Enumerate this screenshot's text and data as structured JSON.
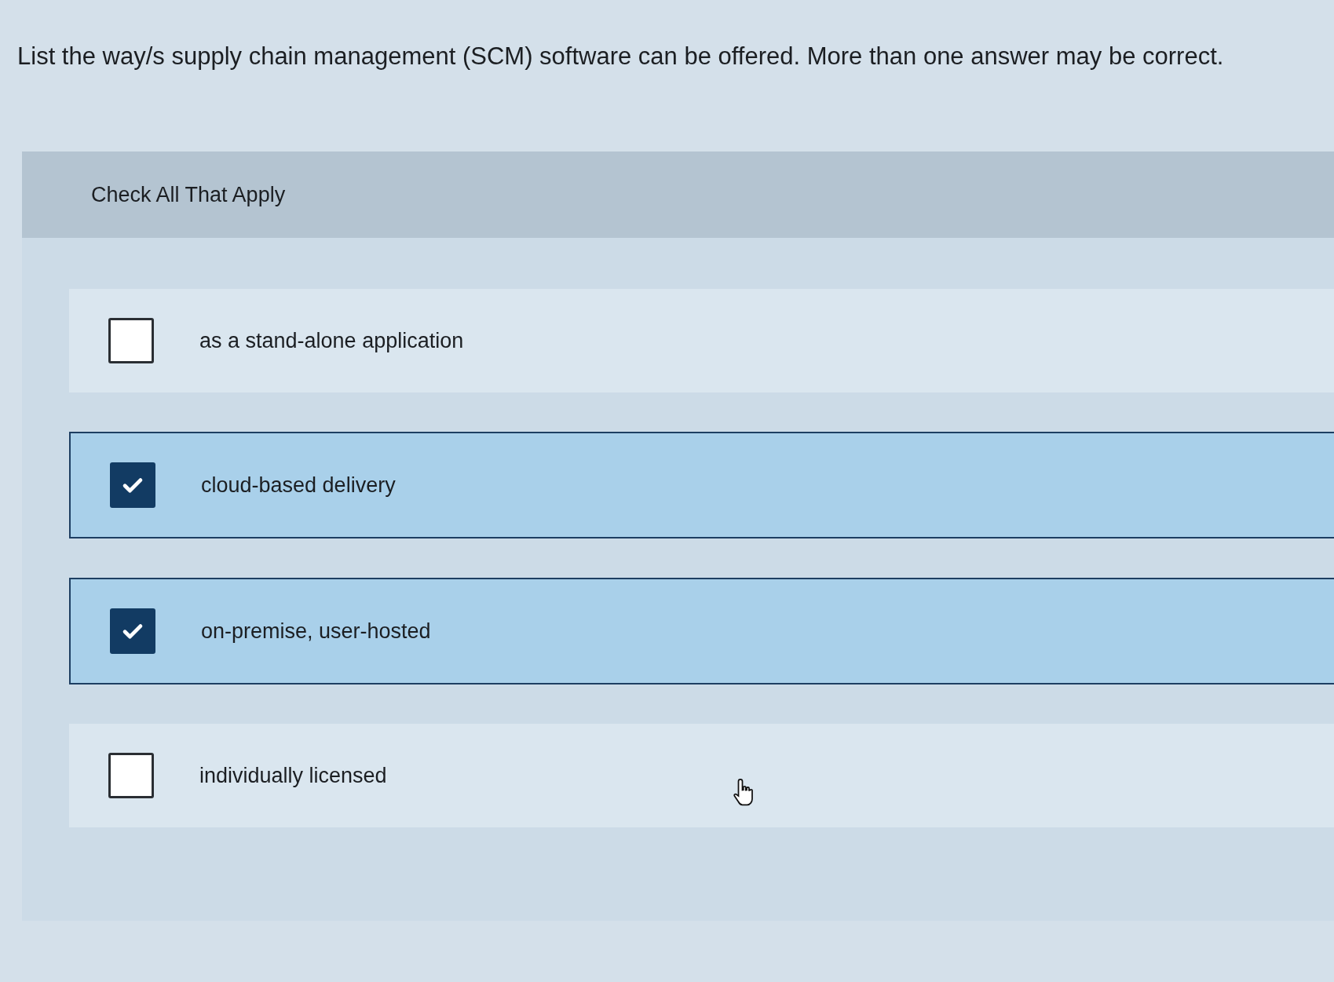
{
  "question": "List the way/s supply chain management (SCM) software can be offered. More than one answer may be correct.",
  "instruction": "Check All That Apply",
  "options": [
    {
      "label": "as a stand-alone application",
      "checked": false
    },
    {
      "label": "cloud-based delivery",
      "checked": true
    },
    {
      "label": "on-premise, user-hosted",
      "checked": true
    },
    {
      "label": "individually licensed",
      "checked": false
    }
  ]
}
